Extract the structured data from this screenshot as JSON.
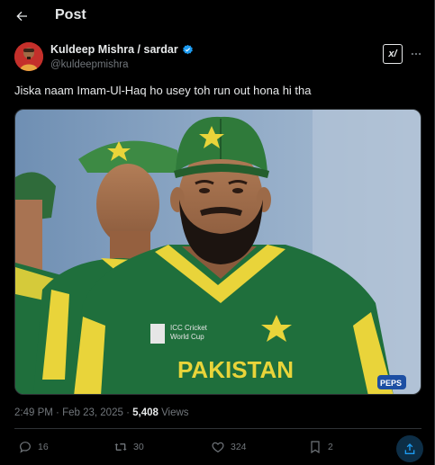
{
  "header": {
    "title": "Post"
  },
  "author": {
    "name": "Kuldeep Mishra / sardar",
    "handle": "@kuldeepmishra"
  },
  "grok_label": "x/",
  "tweet": {
    "text": "Jiska naam Imam-Ul-Haq ho usey toh run out hona hi tha"
  },
  "media": {
    "jersey_text": "PAKISTAN",
    "badge_text": "ICC Cricket World Cup",
    "sponsor_text": "PEPS"
  },
  "meta": {
    "time": "2:49 PM",
    "separator": "·",
    "date": "Feb 23, 2025",
    "views_count": "5,408",
    "views_label": "Views"
  },
  "actions": {
    "replies": "16",
    "reposts": "30",
    "likes": "324",
    "bookmarks": "2"
  },
  "colors": {
    "background": "#000000",
    "text": "#e7e9ea",
    "muted": "#71767b",
    "verified": "#1d9bf0",
    "jersey_green": "#1f6f3c",
    "jersey_yellow": "#e9d43a"
  }
}
